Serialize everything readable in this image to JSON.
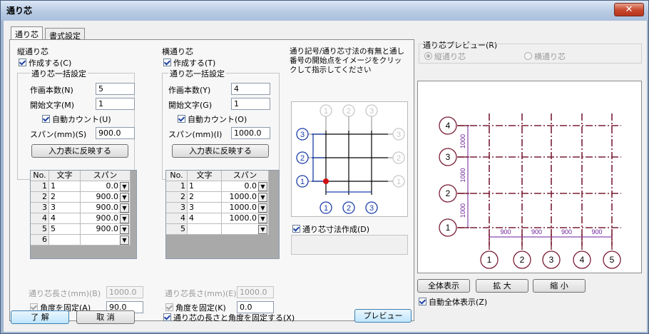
{
  "window": {
    "title": "通り芯",
    "close": "✕"
  },
  "tabs": [
    {
      "label": "通り芯"
    },
    {
      "label": "書式設定"
    }
  ],
  "vertical": {
    "heading": "縦通り芯",
    "create_label": "作成する(C)",
    "batch_heading": "通り芯一括設定",
    "count_label": "作画本数(N)",
    "count_value": "5",
    "start_label": "開始文字(M)",
    "start_value": "1",
    "autocount_label": "自動カウント(U)",
    "span_label": "スパン(mm)(S)",
    "span_value": "900.0",
    "apply_button": "入力表に反映する",
    "table": {
      "headers": [
        "No.",
        "文字",
        "スパン"
      ],
      "rows": [
        {
          "no": "1",
          "char": "1",
          "span": "0.0"
        },
        {
          "no": "2",
          "char": "2",
          "span": "900.0"
        },
        {
          "no": "3",
          "char": "3",
          "span": "900.0"
        },
        {
          "no": "4",
          "char": "4",
          "span": "900.0"
        },
        {
          "no": "5",
          "char": "5",
          "span": "900.0"
        },
        {
          "no": "6",
          "char": "",
          "span": ""
        }
      ]
    },
    "length_label": "通り芯長さ(mm)(B)",
    "length_value": "1000.0",
    "angle_label": "角度を固定(A)",
    "angle_value": "90.0"
  },
  "horizontal": {
    "heading": "横通り芯",
    "create_label": "作成する(T)",
    "batch_heading": "通り芯一括設定",
    "count_label": "作画本数(Y)",
    "count_value": "4",
    "start_label": "開始文字(G)",
    "start_value": "1",
    "autocount_label": "自動カウント(O)",
    "span_label": "スパン(mm)(I)",
    "span_value": "1000.0",
    "apply_button": "入力表に反映する",
    "table": {
      "headers": [
        "No.",
        "文字",
        "スパン"
      ],
      "rows": [
        {
          "no": "1",
          "char": "1",
          "span": "0.0"
        },
        {
          "no": "2",
          "char": "2",
          "span": "1000.0"
        },
        {
          "no": "3",
          "char": "3",
          "span": "1000.0"
        },
        {
          "no": "4",
          "char": "4",
          "span": "1000.0"
        },
        {
          "no": "5",
          "char": "",
          "span": ""
        }
      ]
    },
    "length_label": "通り芯長さ(mm)(E)",
    "length_value": "1000.0",
    "angle_label": "角度を固定(K)",
    "angle_value": "0.0"
  },
  "hint": {
    "text": "通り記号/通り芯寸法の有無と通し番号の開始点をイメージをクリックして指示してください"
  },
  "dimension_create_label": "通り芯寸法作成(D)",
  "preview": {
    "group_label": "通り芯プレビュー(R)",
    "radio_vertical": "縦通り芯",
    "radio_horizontal": "横通り芯",
    "bottom_labels": [
      "1",
      "2",
      "3",
      "4",
      "5"
    ],
    "left_labels": [
      "4",
      "3",
      "2",
      "1"
    ],
    "span_labels_x": [
      "900",
      "900",
      "900",
      "900"
    ],
    "span_labels_y": [
      "1000",
      "1000",
      "1000"
    ],
    "line_color": "#7a1e36",
    "dim_color": "#6a1e9a"
  },
  "preview_buttons": {
    "fit": "全体表示",
    "zoom_in": "拡 大",
    "zoom_out": "縮 小"
  },
  "auto_fit_label": "自動全体表示(Z)",
  "footer": {
    "ok": "了 解",
    "cancel": "取 消",
    "fix_label": "通り芯の長さと角度を固定する(X)",
    "preview": "プレビュー"
  },
  "mini_diagram": {
    "top_labels": [
      "1",
      "2",
      "3"
    ],
    "bottom_labels": [
      "1",
      "2",
      "3"
    ],
    "left_labels": [
      "3",
      "2",
      "1"
    ],
    "right_labels": [
      "3",
      "2",
      "1"
    ]
  }
}
